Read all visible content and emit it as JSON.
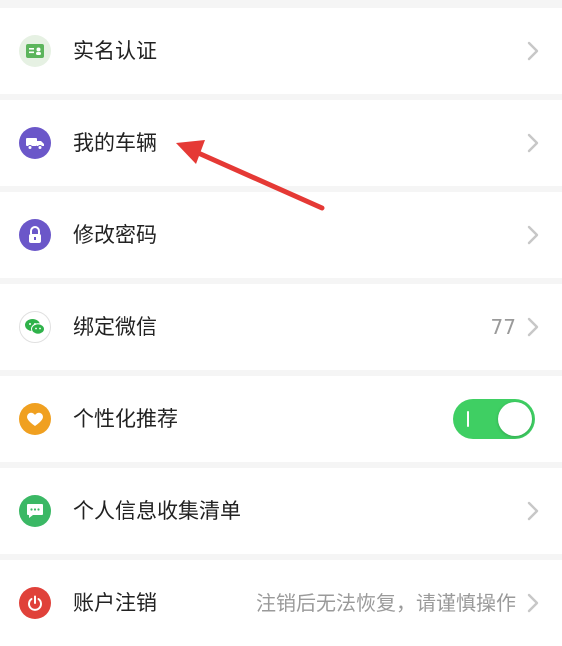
{
  "settings": {
    "items": [
      {
        "label": "实名认证",
        "icon": "id-card-icon",
        "icon_color": "#e6f1e3"
      },
      {
        "label": "我的车辆",
        "icon": "truck-icon",
        "icon_color": "#6b57c9"
      },
      {
        "label": "修改密码",
        "icon": "lock-icon",
        "icon_color": "#6b57c9"
      },
      {
        "label": "绑定微信",
        "icon": "wechat-icon",
        "icon_color": "#ffffff",
        "value": "77"
      },
      {
        "label": "个性化推荐",
        "icon": "heart-icon",
        "icon_color": "#f0a020",
        "toggle_on": true
      },
      {
        "label": "个人信息收集清单",
        "icon": "message-icon",
        "icon_color": "#3bb865"
      },
      {
        "label": "账户注销",
        "icon": "power-icon",
        "icon_color": "#e0413a",
        "value": "注销后无法恢复，请谨慎操作"
      }
    ]
  },
  "annotation": {
    "color": "#e53935"
  },
  "colors": {
    "accent_green": "#3fcf63",
    "chevron": "#c7c7c7"
  }
}
